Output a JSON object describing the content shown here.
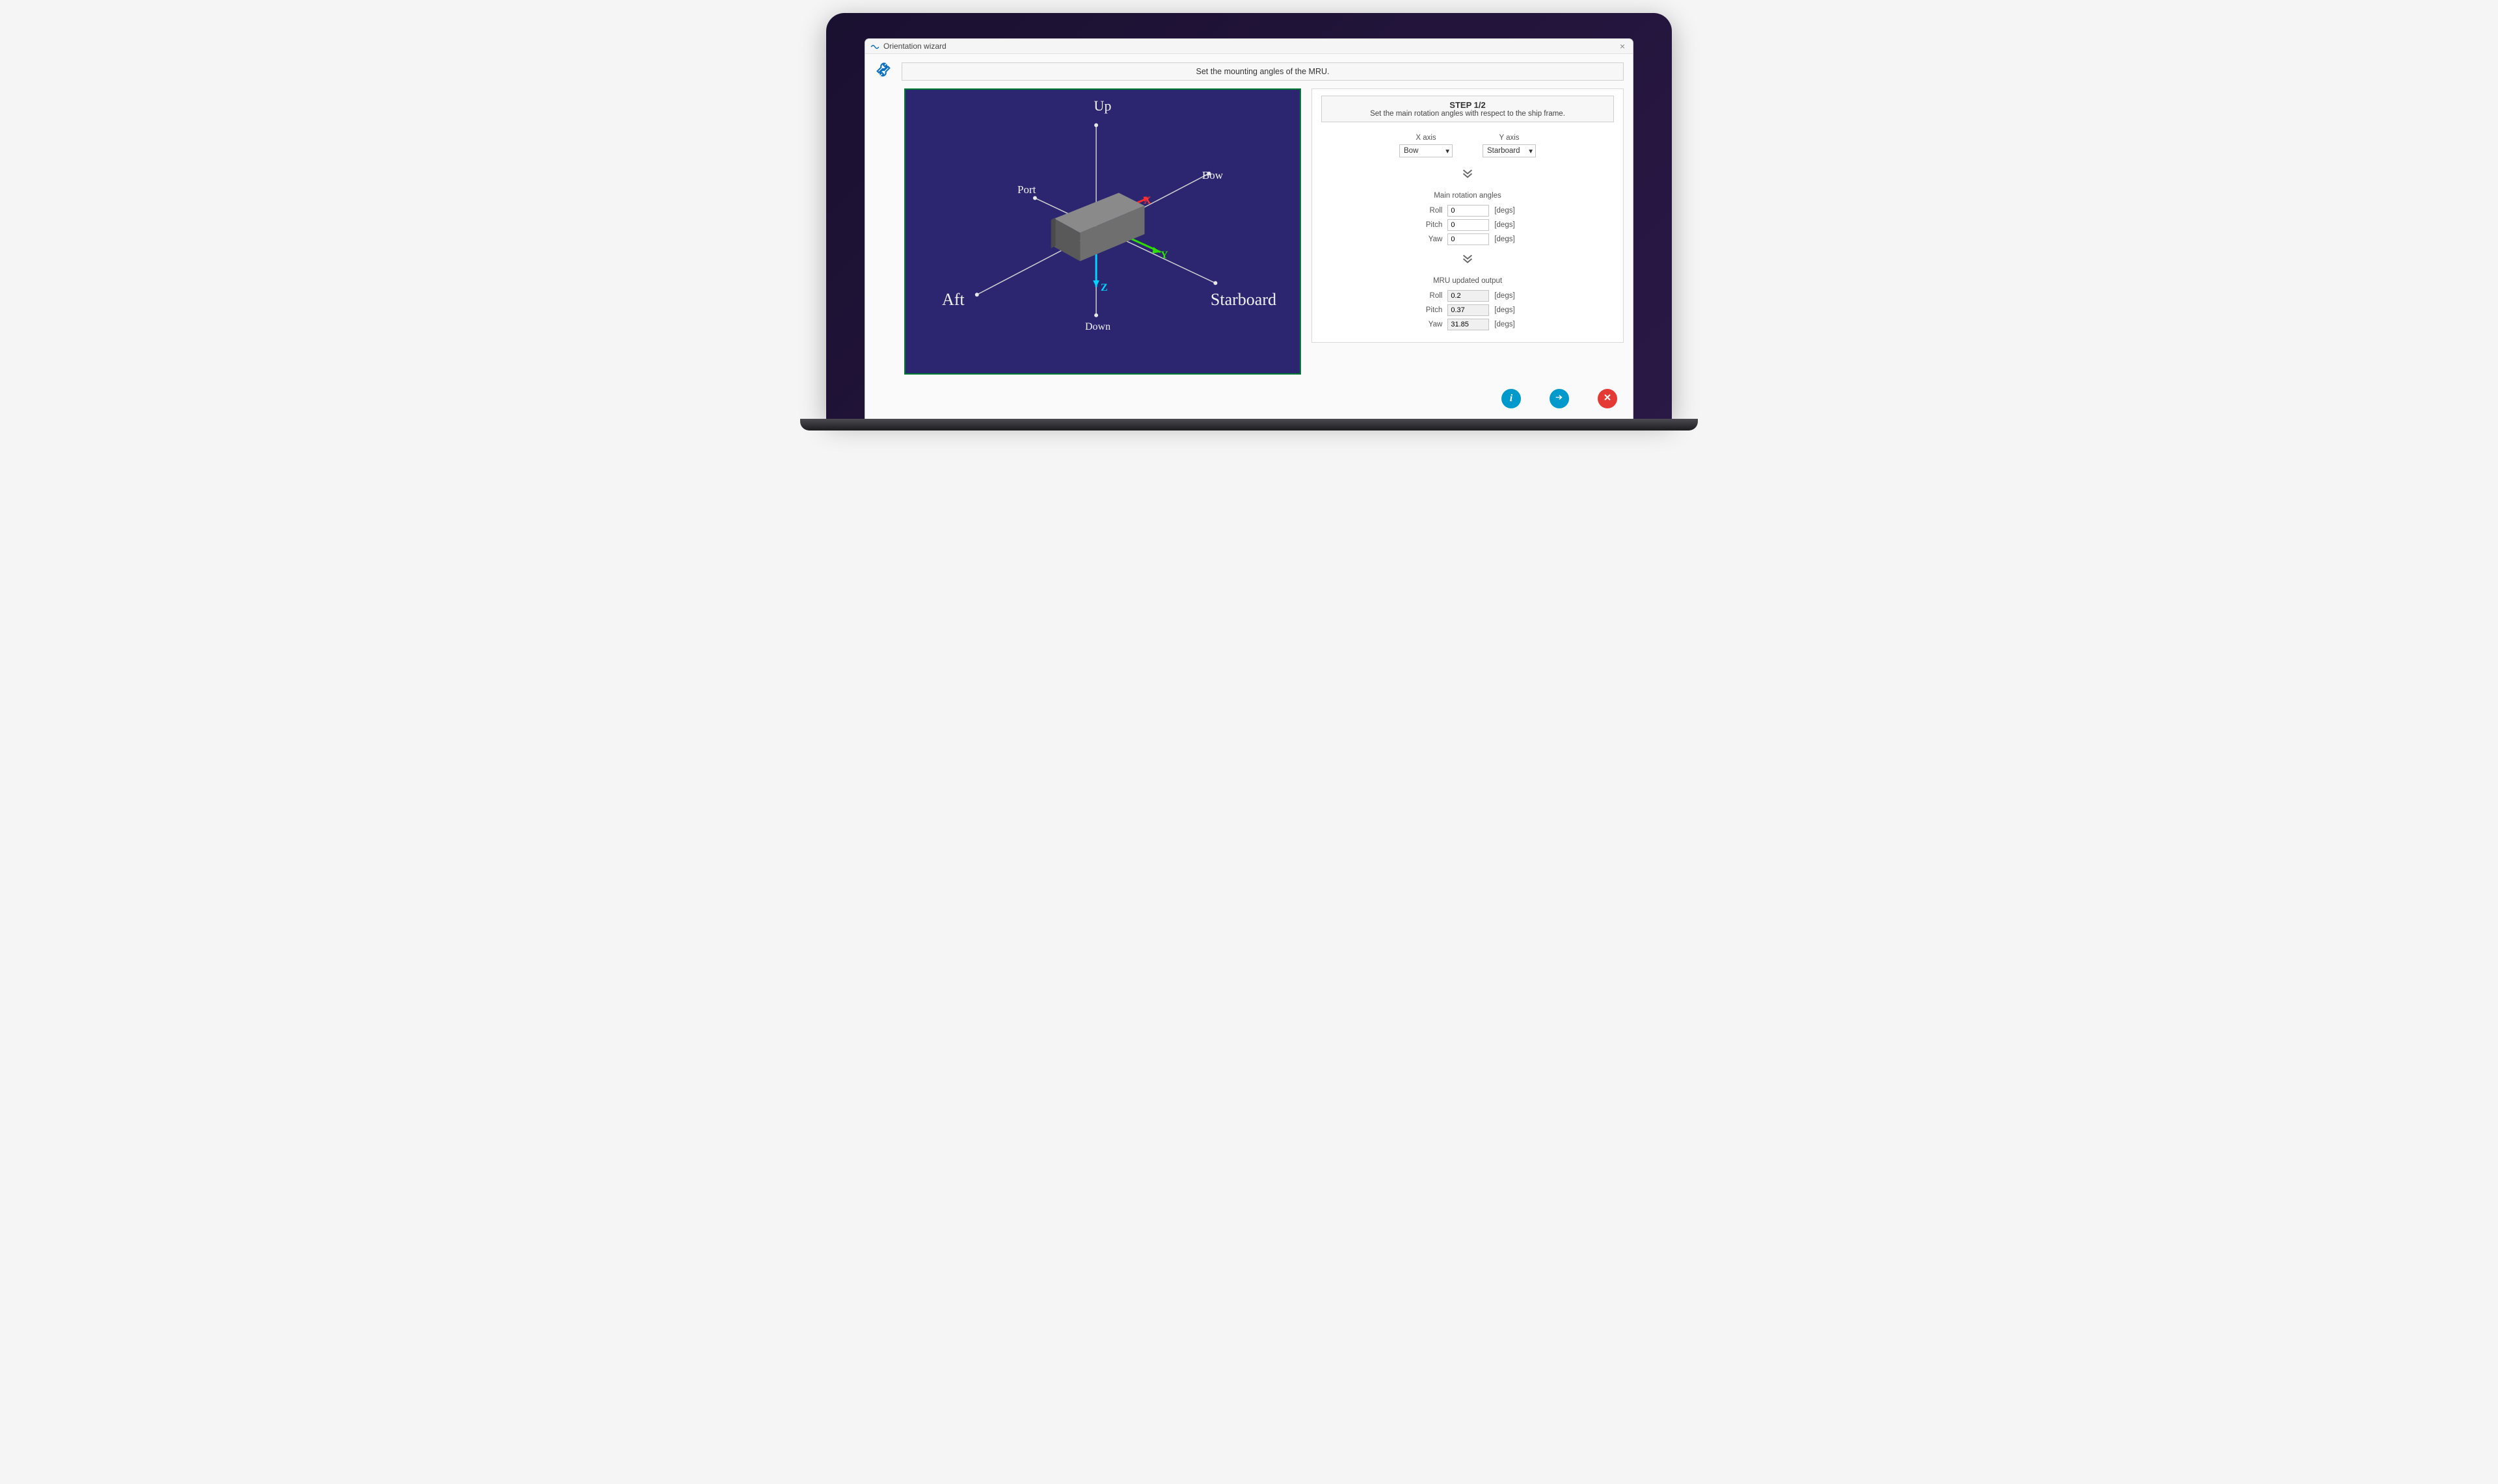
{
  "window": {
    "title": "Orientation wizard"
  },
  "instruction": "Set the mounting angles of the MRU.",
  "diagram": {
    "labels": {
      "up": "Up",
      "down": "Down",
      "port": "Port",
      "bow": "Bow",
      "aft": "Aft",
      "starboard": "Starboard",
      "x": "X",
      "y": "Y",
      "z": "Z"
    }
  },
  "panel": {
    "step_title": "STEP 1/2",
    "step_sub": "Set the main rotation angles with respect to the ship frame.",
    "x_axis_label": "X axis",
    "y_axis_label": "Y axis",
    "x_axis_value": "Bow",
    "y_axis_value": "Starboard",
    "main_title": "Main rotation angles",
    "output_title": "MRU updated output",
    "roll_label": "Roll",
    "pitch_label": "Pitch",
    "yaw_label": "Yaw",
    "unit": "[degs]",
    "main": {
      "roll": "0",
      "pitch": "0",
      "yaw": "0"
    },
    "output": {
      "roll": "0.2",
      "pitch": "0.37",
      "yaw": "31.85"
    }
  }
}
